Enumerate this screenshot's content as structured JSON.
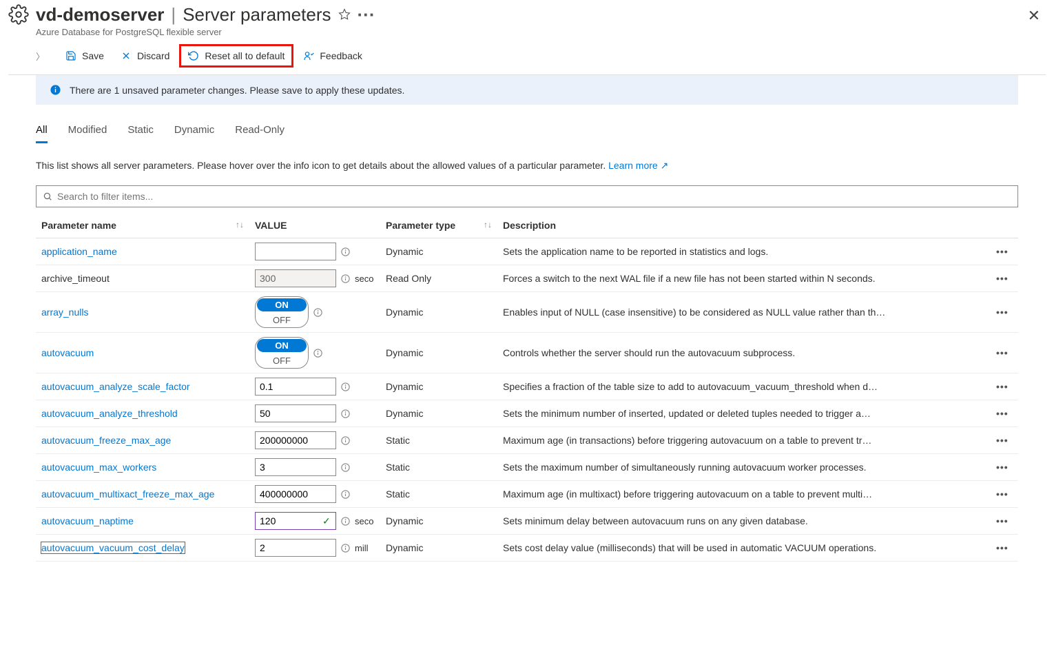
{
  "header": {
    "server_name": "vd-demoserver",
    "page_title": "Server parameters",
    "subtitle": "Azure Database for PostgreSQL flexible server",
    "more_ellipsis": "···"
  },
  "toolbar": {
    "save": "Save",
    "discard": "Discard",
    "reset": "Reset all to default",
    "feedback": "Feedback"
  },
  "info_bar": "There are 1 unsaved parameter changes.  Please save to apply these updates.",
  "tabs": [
    "All",
    "Modified",
    "Static",
    "Dynamic",
    "Read-Only"
  ],
  "active_tab": 0,
  "description": "This list shows all server parameters. Please hover over the info icon to get details about the allowed values of a particular parameter. ",
  "learn_more": "Learn more",
  "search_placeholder": "Search to filter items...",
  "columns": {
    "name": "Parameter name",
    "value": "VALUE",
    "type": "Parameter type",
    "desc": "Description"
  },
  "rows": [
    {
      "name": "application_name",
      "link": true,
      "value": "",
      "value_kind": "text",
      "unit": "",
      "type": "Dynamic",
      "desc": "Sets the application name to be reported in statistics and logs."
    },
    {
      "name": "archive_timeout",
      "link": false,
      "value": "300",
      "value_kind": "readonly",
      "unit": "seconds",
      "type": "Read Only",
      "desc": "Forces a switch to the next WAL file if a new file has not been started within N seconds."
    },
    {
      "name": "array_nulls",
      "link": true,
      "value": "ON",
      "value_kind": "toggle",
      "unit": "",
      "type": "Dynamic",
      "desc": "Enables input of NULL (case insensitive) to be considered as NULL value rather than th…"
    },
    {
      "name": "autovacuum",
      "link": true,
      "value": "ON",
      "value_kind": "toggle",
      "unit": "",
      "type": "Dynamic",
      "desc": "Controls whether the server should run the autovacuum subprocess."
    },
    {
      "name": "autovacuum_analyze_scale_factor",
      "link": true,
      "value": "0.1",
      "value_kind": "text",
      "unit": "",
      "type": "Dynamic",
      "desc": "Specifies a fraction of the table size to add to autovacuum_vacuum_threshold when d…"
    },
    {
      "name": "autovacuum_analyze_threshold",
      "link": true,
      "value": "50",
      "value_kind": "text",
      "unit": "",
      "type": "Dynamic",
      "desc": "Sets the minimum number of inserted, updated or deleted tuples needed to trigger a…"
    },
    {
      "name": "autovacuum_freeze_max_age",
      "link": true,
      "value": "200000000",
      "value_kind": "text",
      "unit": "",
      "type": "Static",
      "desc": "Maximum age (in transactions) before triggering autovacuum on a table to prevent tr…"
    },
    {
      "name": "autovacuum_max_workers",
      "link": true,
      "value": "3",
      "value_kind": "text",
      "unit": "",
      "type": "Static",
      "desc": "Sets the maximum number of simultaneously running autovacuum worker processes."
    },
    {
      "name": "autovacuum_multixact_freeze_max_age",
      "link": true,
      "value": "400000000",
      "value_kind": "text",
      "unit": "",
      "type": "Static",
      "desc": "Maximum age (in multixact) before triggering autovacuum on a table to prevent multi…"
    },
    {
      "name": "autovacuum_naptime",
      "link": true,
      "value": "120",
      "value_kind": "changed",
      "unit": "seconds",
      "type": "Dynamic",
      "desc": "Sets minimum delay between autovacuum runs on any given database."
    },
    {
      "name": "autovacuum_vacuum_cost_delay",
      "link": true,
      "focused": true,
      "value": "2",
      "value_kind": "text",
      "unit": "milliseconds",
      "type": "Dynamic",
      "desc": "Sets cost delay value (milliseconds) that will be used in automatic VACUUM operations."
    }
  ]
}
